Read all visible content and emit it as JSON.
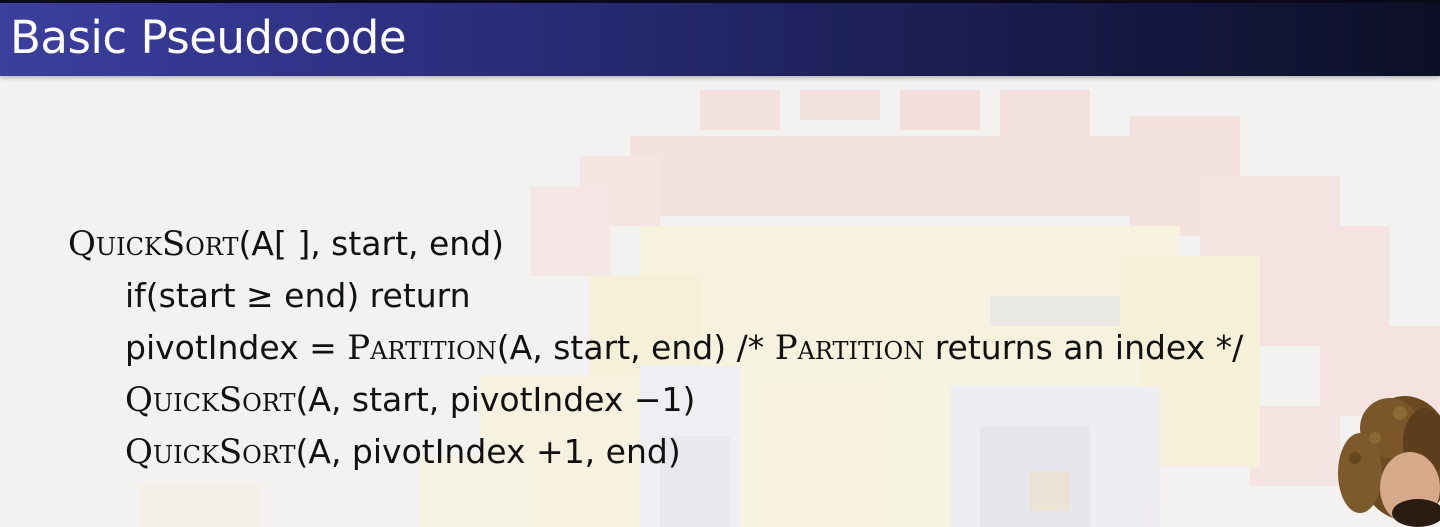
{
  "slide": {
    "title": "Basic Pseudocode"
  },
  "code": {
    "line1": {
      "fn": "QuickSort",
      "rest": "(A[ ], start, end)"
    },
    "line2": {
      "text": "if(start ≥ end) return"
    },
    "line3": {
      "pre": "pivotIndex = ",
      "fn": "Partition",
      "mid": "(A, start, end) /* ",
      "fn2": "Partition",
      "post": " returns an index */"
    },
    "line4": {
      "fn": "QuickSort",
      "rest": "(A, start, pivotIndex −1)"
    },
    "line5": {
      "fn": "QuickSort",
      "rest": "(A, pivotIndex +1, end)"
    }
  },
  "colors": {
    "title_bar_start": "#3b3f9e",
    "title_bar_end": "#0d0f27",
    "title_text": "#ffffff",
    "code_text": "#111111"
  },
  "icons": {
    "background": "pixel-art-background",
    "presenter": "presenter-webcam"
  }
}
